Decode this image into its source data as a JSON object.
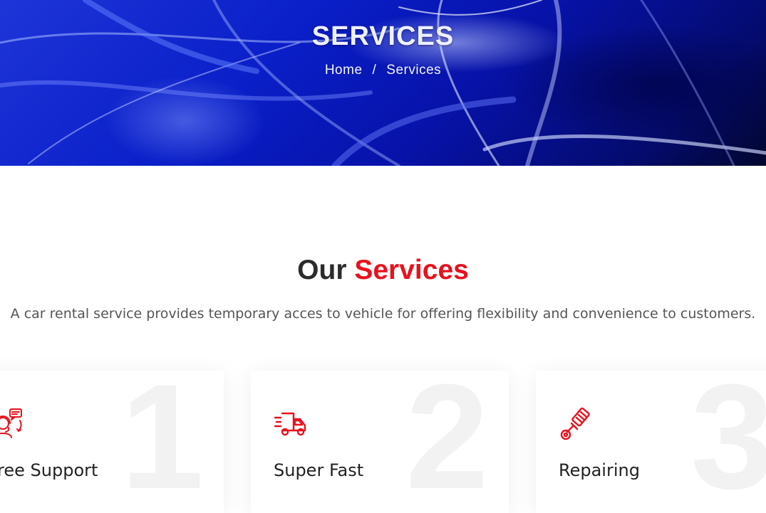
{
  "hero": {
    "title": "SERVICES",
    "breadcrumb": {
      "home": "Home",
      "separator": "/",
      "current": "Services"
    }
  },
  "section": {
    "title_part1": "Our",
    "title_part2": "Services",
    "description": "A car rental service provides temporary acces to vehicle for offering flexibility and convenience to customers."
  },
  "services": [
    {
      "number": "1",
      "title": "Free Support",
      "icon": "customer-support-icon"
    },
    {
      "number": "2",
      "title": "Super Fast",
      "icon": "fast-delivery-truck-icon"
    },
    {
      "number": "3",
      "title": "Repairing",
      "icon": "spark-plug-icon"
    }
  ],
  "colors": {
    "accent": "#e8111e",
    "hero_blue": "#0a1fc8",
    "heading": "#2b2b2b"
  }
}
